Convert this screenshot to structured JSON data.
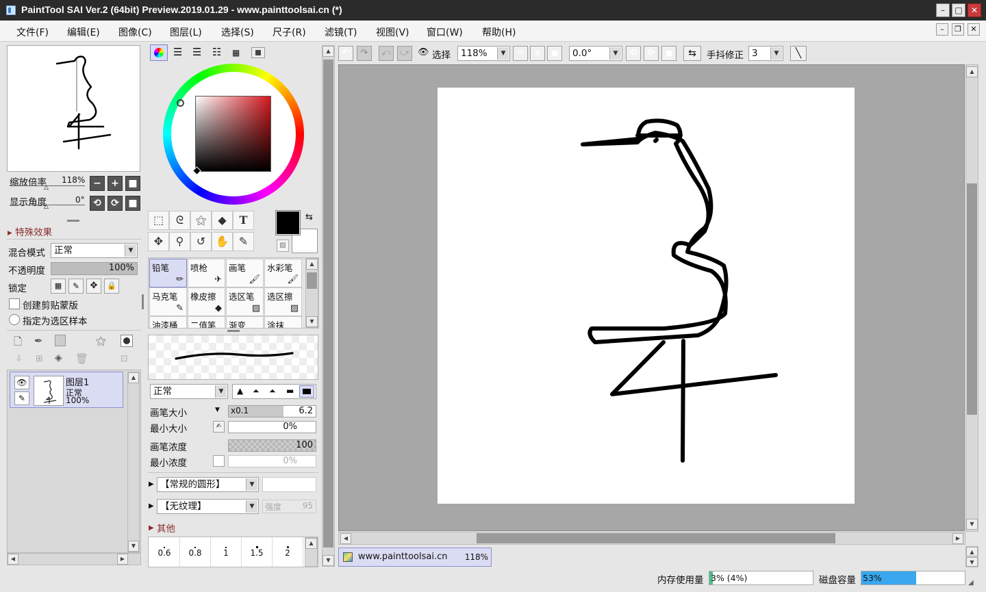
{
  "window": {
    "title": "PaintTool SAI Ver.2 (64bit) Preview.2019.01.29 - www.painttoolsai.cn (*)",
    "min": "–",
    "max": "□",
    "close": "✕"
  },
  "menu": [
    "文件(F)",
    "编辑(E)",
    "图像(C)",
    "图层(L)",
    "选择(S)",
    "尺子(R)",
    "滤镜(T)",
    "视图(V)",
    "窗口(W)",
    "帮助(H)"
  ],
  "navigator": {
    "zoom_label": "缩放倍率",
    "zoom_value": "118%",
    "angle_label": "显示角度",
    "angle_value": "0°"
  },
  "layer_props": {
    "effects_label": "特殊效果",
    "blend_label": "混合模式",
    "blend_value": "正常",
    "opacity_label": "不透明度",
    "opacity_value": "100%",
    "opacity_fraction": 1.0,
    "lock_label": "锁定",
    "clip_label": "创建剪贴蒙版",
    "sample_label": "指定为选区样本"
  },
  "layers": [
    {
      "name": "图层1",
      "mode": "正常",
      "opacity": "100%"
    }
  ],
  "tools": {
    "text_tool": "T"
  },
  "brushes": {
    "row1": [
      "铅笔",
      "喷枪",
      "画笔",
      "水彩笔"
    ],
    "row2": [
      "马克笔",
      "橡皮擦",
      "选区笔",
      "选区擦"
    ],
    "row3": [
      "油漆桶",
      "二值笔",
      "渐变",
      "涂抹"
    ]
  },
  "brush_settings": {
    "mode": "正常",
    "size_label": "画笔大小",
    "size_mult": "x0.1",
    "size_value": "6.2",
    "min_size_label": "最小大小",
    "min_size_value": "0%",
    "density_label": "画笔浓度",
    "density_value": "100",
    "min_density_label": "最小浓度",
    "min_density_value": "0%",
    "shape": "【常规的圆形】",
    "texture": "【无纹理】",
    "strength_label": "强度",
    "strength_value": "95",
    "other_label": "其他",
    "dot_sizes": [
      "0.6",
      "0.8",
      "1",
      "1.5",
      "2"
    ]
  },
  "toolbar": {
    "selection_label": "选择",
    "zoom": "118%",
    "angle": "0.0°",
    "stabilizer_label": "手抖修正",
    "stabilizer_value": "3"
  },
  "canvas_tab": {
    "name": "www.painttoolsai.cn",
    "zoom": "118%"
  },
  "status": {
    "memory_label": "内存使用量",
    "memory_value": "3% (4%)",
    "memory_fraction": 0.03,
    "disk_label": "磁盘容量",
    "disk_value": "53%",
    "disk_fraction": 0.53
  },
  "colors": {
    "accent": "#3a7bd5",
    "primary": "#000000",
    "secondary": "#ffffff",
    "disk_bar": "#3aa7ef",
    "memory_bar": "#4cc08d"
  }
}
